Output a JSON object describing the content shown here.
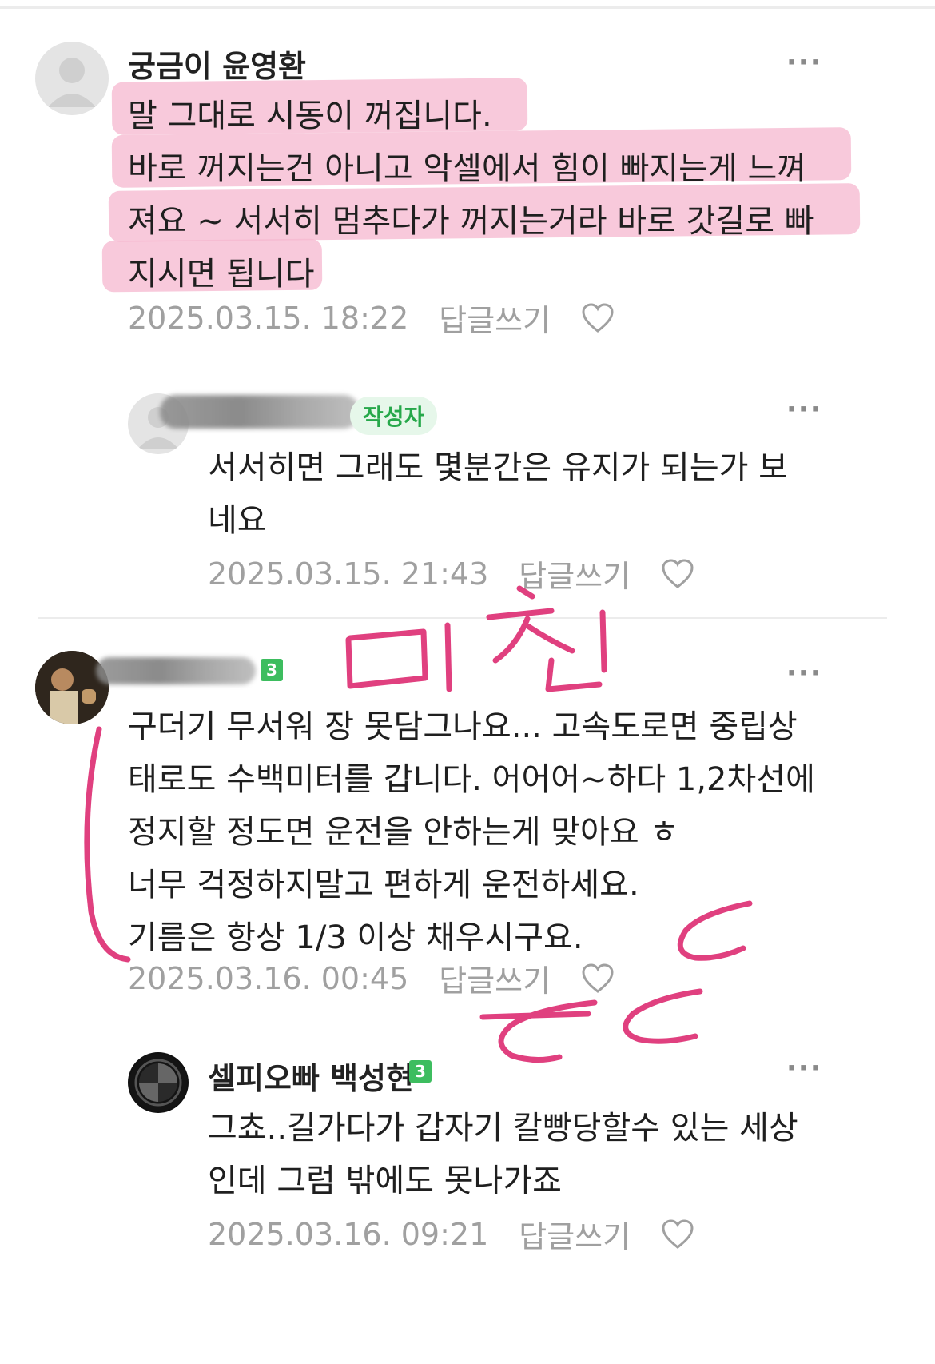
{
  "comments": [
    {
      "author": "궁금이 윤영환",
      "lines": [
        "말 그대로 시동이 꺼집니다.",
        "바로 꺼지는건 아니고 악셀에서 힘이 빠지는게 느껴",
        "져요 ~ 서서히 멈추다가 꺼지는거라 바로 갓길로 빠",
        "지시면 됩니다"
      ],
      "timestamp": "2025.03.15. 18:22",
      "reply_label": "답글쓰기"
    },
    {
      "author_badge": "작성자",
      "lines": [
        "서서히면 그래도 몇분간은 유지가 되는가 보",
        "네요"
      ],
      "timestamp": "2025.03.15. 21:43",
      "reply_label": "답글쓰기"
    },
    {
      "level": "3",
      "lines": [
        "구더기 무서워 장 못담그나요... 고속도로면 중립상",
        "태로도 수백미터를 갑니다. 어어어~하다 1,2차선에",
        "정지할 정도면 운전을 안하는게 맞아요 ㅎ",
        "너무 걱정하지말고 편하게 운전하세요.",
        "기름은 항상 1/3 이상 채우시구요."
      ],
      "timestamp": "2025.03.16. 00:45",
      "reply_label": "답글쓰기"
    },
    {
      "author": "셀피오빠 백성현",
      "level": "3",
      "lines": [
        "그쵸..길가다가 갑자기 칼빵당할수 있는 세상",
        "인데 그럼 밖에도 못나가죠"
      ],
      "timestamp": "2025.03.16. 09:21",
      "reply_label": "답글쓰기"
    }
  ],
  "more_icon": "···",
  "handwriting": {
    "text": "미친 ㄷㄷㄷ",
    "color": "#e0407f"
  },
  "highlight_color": "#f5b7cf"
}
